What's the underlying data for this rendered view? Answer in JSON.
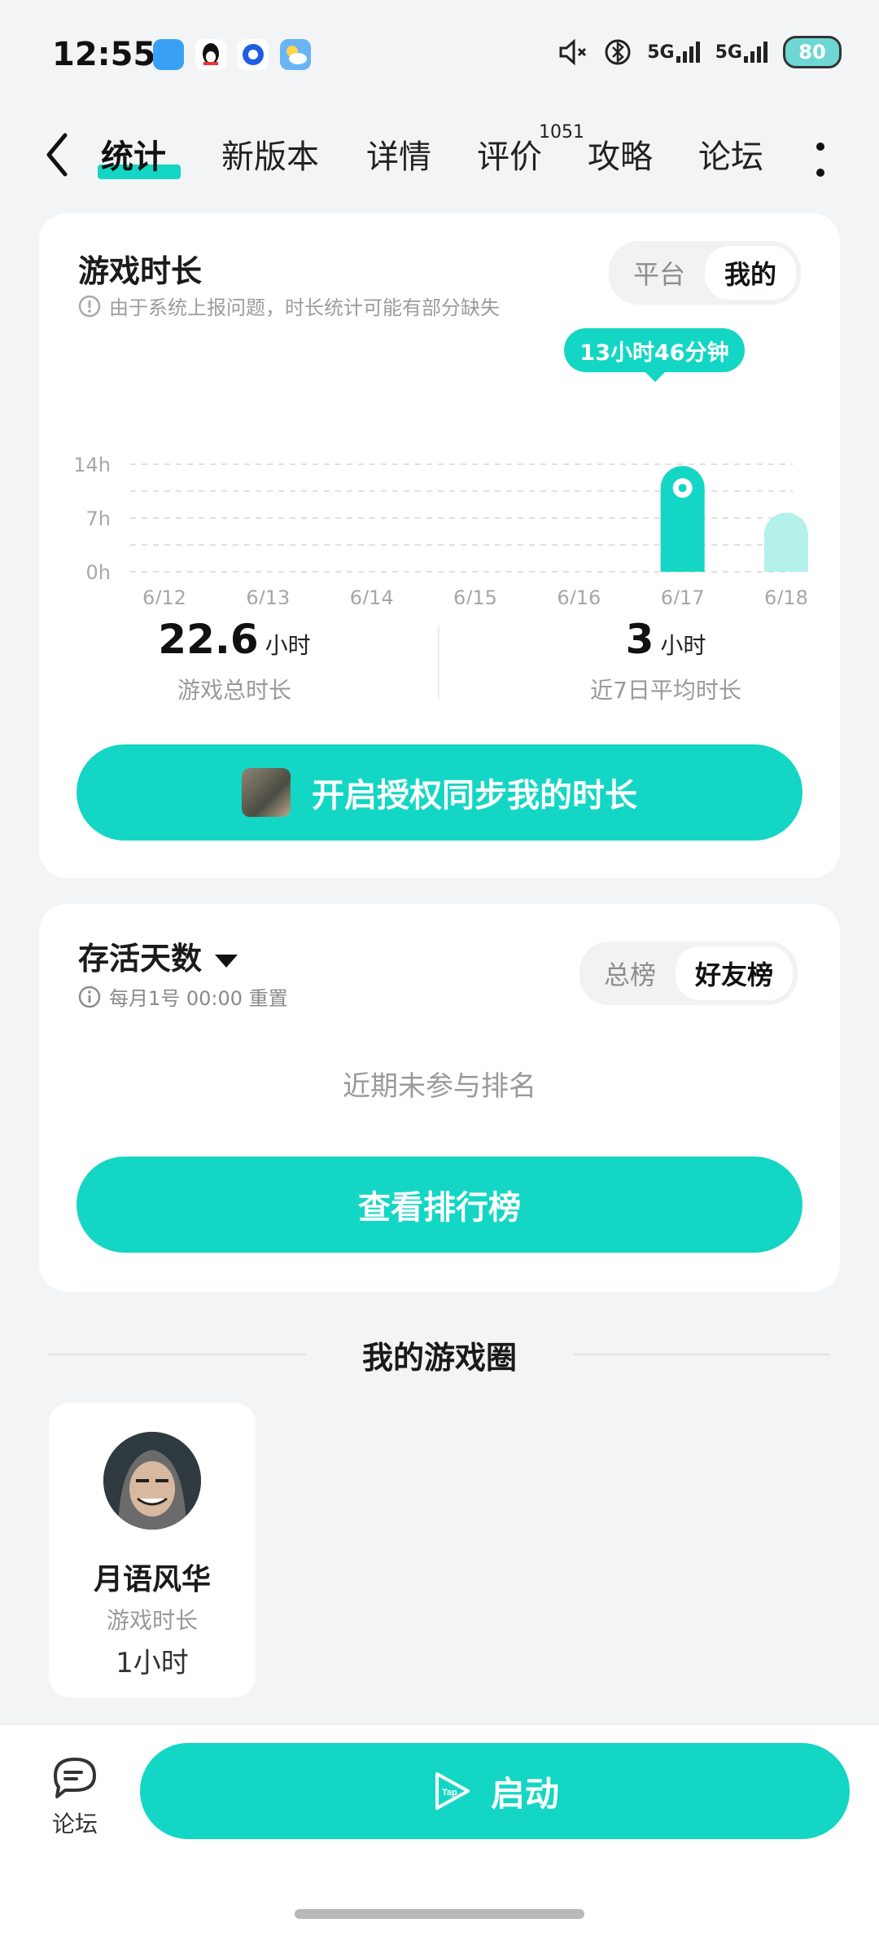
{
  "status_bar": {
    "time": "12:55",
    "battery": "80",
    "signal1": "5G",
    "signal2": "5G"
  },
  "tabs": {
    "items": [
      "统计",
      "新版本",
      "详情",
      "评价",
      "攻略",
      "论坛"
    ],
    "review_count": "1051"
  },
  "playtime": {
    "title": "游戏时长",
    "note": "由于系统上报问题，时长统计可能有部分缺失",
    "segment": {
      "option1": "平台",
      "option2": "我的",
      "selected": "我的"
    },
    "tooltip": "13小时46分钟",
    "total_value": "22.6",
    "total_unit": "小时",
    "total_label": "游戏总时长",
    "avg_value": "3",
    "avg_unit": "小时",
    "avg_label": "近7日平均时长",
    "sync_button": "开启授权同步我的时长"
  },
  "chart_data": {
    "type": "bar",
    "categories": [
      "6/12",
      "6/13",
      "6/14",
      "6/15",
      "6/16",
      "6/17",
      "6/18"
    ],
    "values": [
      0,
      0,
      0,
      0,
      0,
      13.77,
      7.7
    ],
    "ylim": [
      0,
      14
    ],
    "yticks": [
      "0h",
      "7h",
      "14h"
    ],
    "colors": {
      "main": "#14d6c4",
      "light": "#b4f1eb"
    }
  },
  "survival": {
    "title": "存活天数",
    "note": "每月1号 00:00 重置",
    "segment": {
      "option1": "总榜",
      "option2": "好友榜",
      "selected": "好友榜"
    },
    "empty": "近期未参与排名",
    "button": "查看排行榜"
  },
  "circle": {
    "title": "我的游戏圈",
    "friend": {
      "name": "月语风华",
      "label": "游戏时长",
      "value": "1小时"
    }
  },
  "bottom": {
    "forum_label": "论坛",
    "launch_label": "启动"
  },
  "accent": "#14d6c4"
}
